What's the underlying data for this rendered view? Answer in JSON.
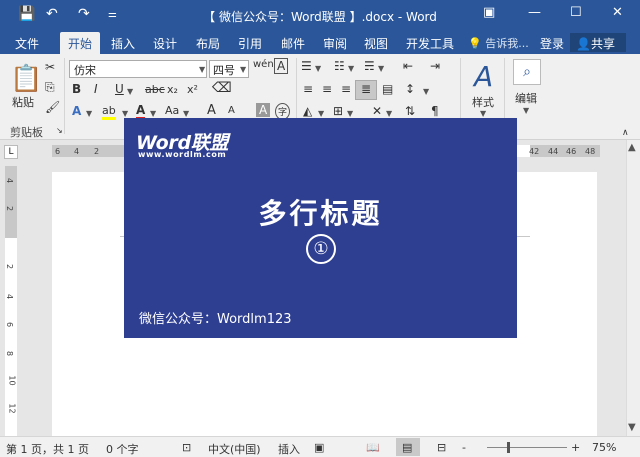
{
  "title_bar": {
    "save_icon": "save-icon",
    "undo_icon": "undo-icon",
    "redo_icon": "redo-icon",
    "customize_icon": "customize-toolbar-icon",
    "title": "【 微信公众号：Word联盟 】.docx - Word",
    "ribbon_options_icon": "ribbon-display-icon",
    "minimize_icon": "minimize-icon",
    "maximize_icon": "maximize-icon",
    "close_icon": "close-icon"
  },
  "tabs": [
    "文件",
    "开始",
    "插入",
    "设计",
    "布局",
    "引用",
    "邮件",
    "审阅",
    "视图",
    "开发工具"
  ],
  "active_tab": "开始",
  "tell_me": "告诉我...",
  "login": "登录",
  "share": "共享",
  "ribbon": {
    "clipboard": {
      "paste": "粘贴",
      "group": "剪贴板"
    },
    "font": {
      "name": "仿宋",
      "size": "四号",
      "bold": "B",
      "italic": "I",
      "underline": "U",
      "strike": "abc",
      "subscript": "x₂",
      "superscript": "x²",
      "text_effect": "A",
      "highlight": "ab",
      "font_color": "A",
      "change_case": "Aa",
      "grow": "A",
      "shrink": "A",
      "char_shading": "A",
      "enclose": "字"
    },
    "styles": {
      "label": "样式"
    },
    "editing": {
      "label": "编辑"
    },
    "colors": {
      "accent": "#2b579a",
      "highlight": "#ffff00",
      "font_color": "#e02020"
    }
  },
  "ruler": {
    "h_ticks": [
      "6",
      "4",
      "2",
      "42",
      "44",
      "46",
      "48"
    ],
    "v_ticks": [
      "4",
      "2",
      "2",
      "4",
      "6",
      "8",
      "10",
      "12"
    ],
    "corner": "L"
  },
  "banner": {
    "logo": "Word联盟",
    "logo_sub": "www.wordlm.com",
    "headline": "多行标题",
    "number": "①",
    "wechat": "微信公众号：Wordlm123",
    "bg_color": "#2e3f92"
  },
  "status_bar": {
    "page": "第 1 页，共 1 页",
    "words": "0 个字",
    "language": "中文(中国)",
    "mode": "插入",
    "zoom": "75%",
    "zoom_minus": "-",
    "zoom_plus": "+"
  }
}
